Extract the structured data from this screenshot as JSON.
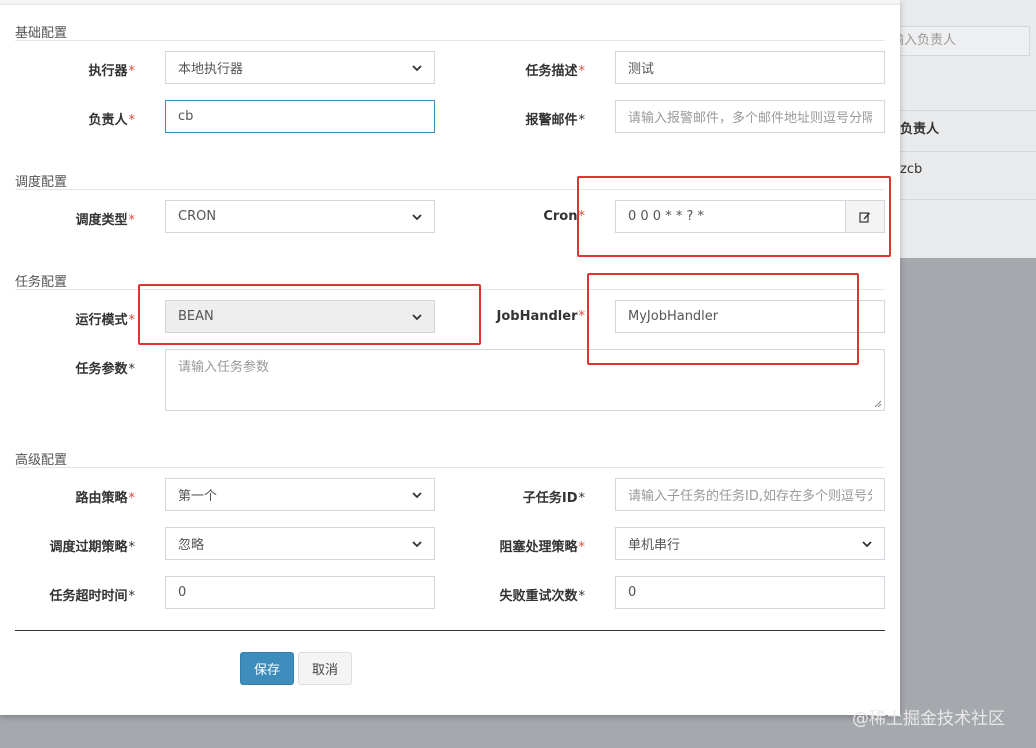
{
  "background": {
    "search_placeholder": "输入负责人",
    "column_header": "负责人",
    "cell_value": "zcb",
    "watermark": "@稀土掘金技术社区"
  },
  "sections": {
    "basic": "基础配置",
    "schedule": "调度配置",
    "task": "任务配置",
    "advanced": "高级配置"
  },
  "required_mark": "*",
  "labels": {
    "executor": "执行器",
    "task_desc": "任务描述",
    "owner": "负责人",
    "alarm_email": "报警邮件",
    "schedule_type": "调度类型",
    "cron": "Cron",
    "run_mode": "运行模式",
    "job_handler": "JobHandler",
    "task_param": "任务参数",
    "route_strategy": "路由策略",
    "child_job_id": "子任务ID",
    "misfire_strategy": "调度过期策略",
    "block_strategy": "阻塞处理策略",
    "timeout": "任务超时时间",
    "fail_retry": "失败重试次数"
  },
  "fields": {
    "executor": "本地执行器",
    "task_desc": "测试",
    "owner": "cb",
    "alarm_email_placeholder": "请输入报警邮件，多个邮件地址则逗号分隔",
    "schedule_type": "CRON",
    "cron": "0 0 0 * * ? *",
    "run_mode": "BEAN",
    "job_handler": "MyJobHandler",
    "task_param_placeholder": "请输入任务参数",
    "route_strategy": "第一个",
    "child_job_id_placeholder": "请输入子任务的任务ID,如存在多个则逗号分隔",
    "misfire_strategy": "忽略",
    "block_strategy": "单机串行",
    "timeout": "0",
    "fail_retry": "0"
  },
  "buttons": {
    "save": "保存",
    "cancel": "取消"
  },
  "colors": {
    "primary": "#3c8dbc",
    "required": "#dd4b39",
    "highlight": "#e03434"
  }
}
